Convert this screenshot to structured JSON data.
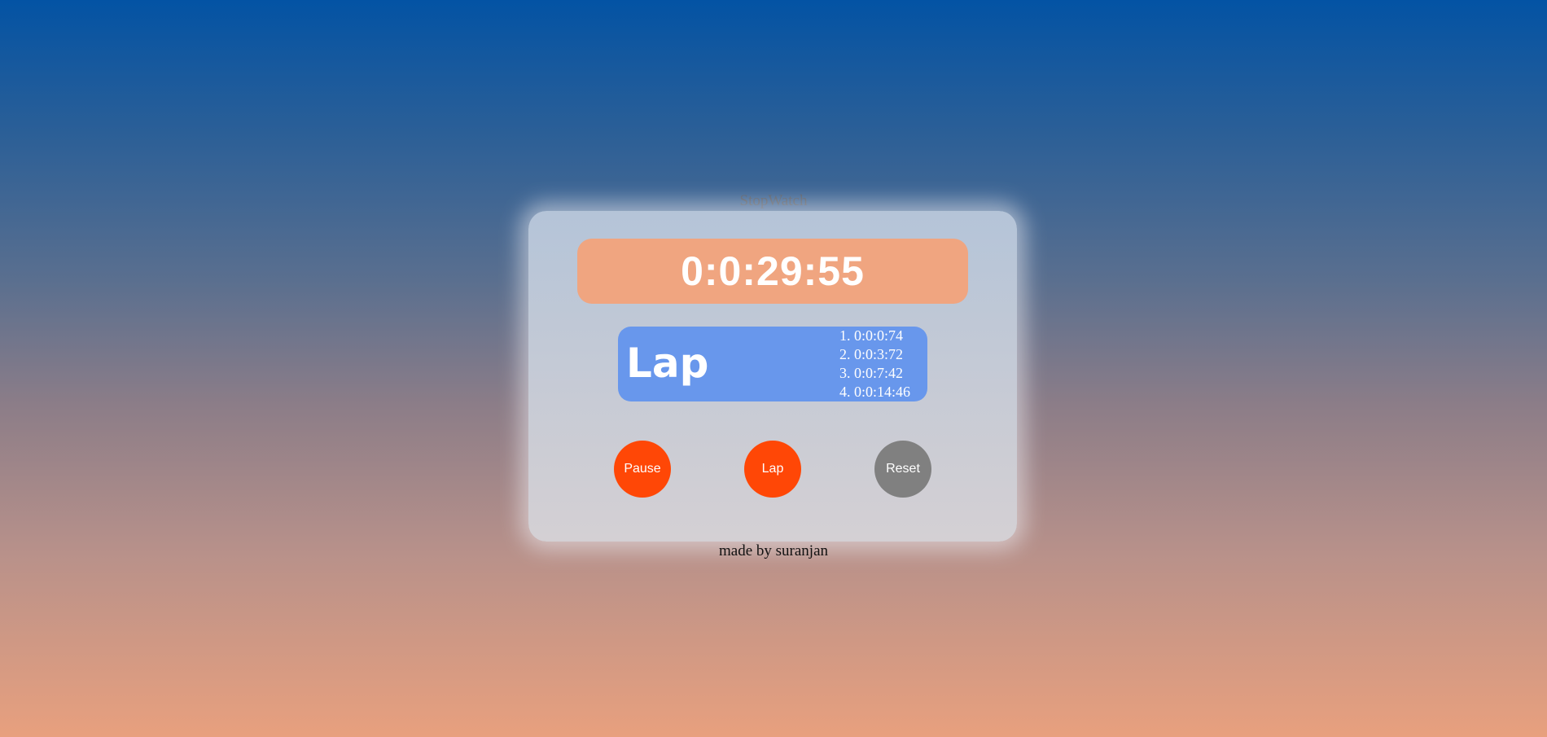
{
  "app": {
    "title": "StopWatch",
    "footer": "made by suranjan"
  },
  "display": {
    "time": "0:0:29:55"
  },
  "laps": {
    "heading": "Lap",
    "items": [
      "1. 0:0:0:74",
      "2. 0:0:3:72",
      "3. 0:0:7:42",
      "4. 0:0:14:46"
    ]
  },
  "controls": {
    "pause_label": "Pause",
    "lap_label": "Lap",
    "reset_label": "Reset"
  },
  "colors": {
    "display_bg": "#f0a580",
    "lap_bg": "#6897ec",
    "primary_button": "#ff4706",
    "reset_button": "#808080"
  }
}
